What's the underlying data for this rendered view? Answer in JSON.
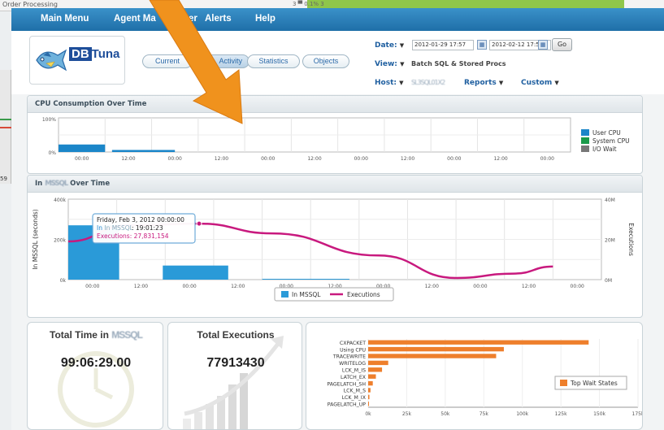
{
  "background": {
    "title": "Order Processing",
    "cells": "3 ▀  0.1%    3",
    "left_stub": "59"
  },
  "nav": {
    "items": [
      "Main Menu",
      "Agent Manager",
      "Alerts",
      "Help"
    ],
    "visible_items": [
      "Main Menu",
      "Agent Ma",
      "er",
      "Alerts",
      "Help"
    ]
  },
  "logo": {
    "db": "DB",
    "tuna": "Tuna"
  },
  "tabs": [
    "Current",
    "Activity",
    "Statistics",
    "Objects"
  ],
  "tabs_visible": [
    "Current",
    "Activity",
    "Statistics",
    "Objects"
  ],
  "controls": {
    "date_label": "Date:",
    "date_from": "2012-01-29 17:57",
    "date_to": "2012-02-12 17:57",
    "go": "Go",
    "view_label": "View:",
    "view_value": "Batch SQL & Stored Procs",
    "host_label": "Host:",
    "host_value": "SL3SQL01X2",
    "reports": "Reports",
    "custom": "Custom"
  },
  "cpu_panel": {
    "title": "CPU Consumption Over Time",
    "y_ticks": [
      "100%",
      "0%"
    ],
    "x_ticks": [
      "00:00",
      "12:00",
      "00:00",
      "12:00",
      "00:00",
      "12:00",
      "00:00",
      "12:00",
      "00:00",
      "12:00",
      "00:00"
    ],
    "legend": [
      {
        "name": "User CPU",
        "color": "#1b86c9"
      },
      {
        "name": "System CPU",
        "color": "#1a9a4a"
      },
      {
        "name": "I/O Wait",
        "color": "#777777"
      }
    ],
    "bars": [
      {
        "x0": 0,
        "x1": 1,
        "value": 0.22
      },
      {
        "x0": 1.15,
        "x1": 2.5,
        "value": 0.06
      }
    ]
  },
  "mssql_panel": {
    "title_prefix": "In",
    "title_blur": "MSSQL",
    "title_suffix": "Over Time",
    "y_left_ticks": [
      "400k",
      "200k",
      "0k"
    ],
    "y_right_ticks": [
      "40M",
      "20M",
      "0M"
    ],
    "y_left_label": "In MSSQL (seconds)",
    "y_right_label": "Executions",
    "x_ticks": [
      "00:00",
      "12:00",
      "00:00",
      "12:00",
      "00:00",
      "12:00",
      "00:00",
      "12:00",
      "00:00",
      "12:00",
      "00:00"
    ],
    "legend_bar": "In MSSQL",
    "legend_line": "Executions",
    "bar_color": "#2a9ad8",
    "line_color": "#c8197e",
    "tooltip": {
      "date": "Friday, Feb 3, 2012 00:00:00",
      "line1_label": "In MSSQL",
      "line1_value": ": 19:01:23",
      "line2": "Executions: 27,831,154"
    },
    "bars": [
      {
        "x0": 0,
        "x1": 1.05,
        "value": 270000
      },
      {
        "x0": 1.95,
        "x1": 3.3,
        "value": 70000
      },
      {
        "x0": 4.0,
        "x1": 5.8,
        "value": 4000
      }
    ],
    "line": [
      {
        "x": 0,
        "y": 19000000
      },
      {
        "x": 1.25,
        "y": 27000000
      },
      {
        "x": 2.7,
        "y": 27831154
      },
      {
        "x": 4.2,
        "y": 23000000
      },
      {
        "x": 6.4,
        "y": 12000000
      },
      {
        "x": 8.0,
        "y": 800000
      },
      {
        "x": 9.2,
        "y": 3000000
      },
      {
        "x": 10.0,
        "y": 6500000
      }
    ]
  },
  "total_time": {
    "title_prefix": "Total Time in",
    "title_blur": "MSSQL",
    "value": "99:06:29.00"
  },
  "total_exec": {
    "title": "Total Executions",
    "value": "77913430"
  },
  "wait_chart": {
    "type": "bar",
    "orientation": "horizontal",
    "categories": [
      "CXPACKET",
      "Using CPU",
      "TRACEWRITE",
      "WRITELOG",
      "LCK_M_IS",
      "LATCH_EX",
      "PAGELATCH_SH",
      "LCK_M_S",
      "LCK_M_IX",
      "PAGELATCH_UP"
    ],
    "values": [
      143000,
      88000,
      83000,
      13000,
      9000,
      5000,
      3000,
      1500,
      800,
      400
    ],
    "x_ticks": [
      "0k",
      "25k",
      "50k",
      "75k",
      "100k",
      "125k",
      "150k",
      "175k"
    ],
    "xlim": [
      0,
      175000
    ],
    "legend": "Top Wait States",
    "color": "#ee7f2c"
  }
}
